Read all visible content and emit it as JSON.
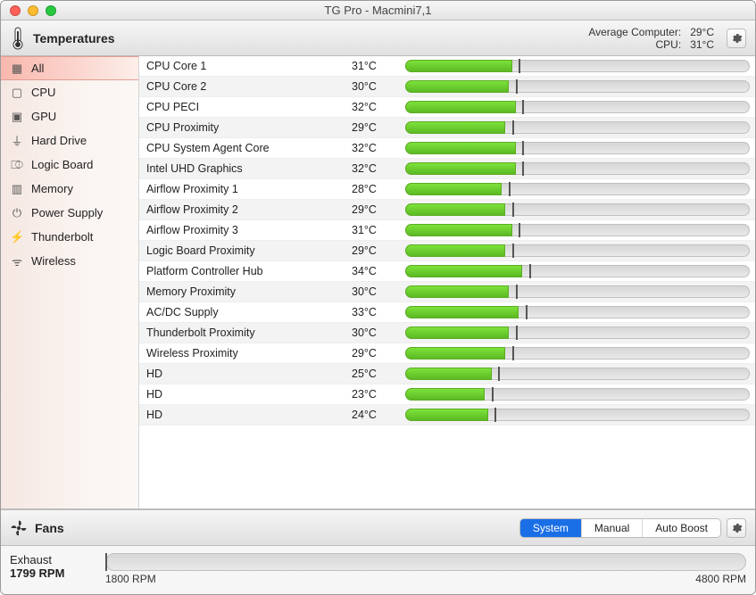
{
  "window": {
    "title": "TG Pro - Macmini7,1"
  },
  "sections": {
    "temperatures": {
      "label": "Temperatures",
      "stats": {
        "avg_label": "Average Computer:",
        "avg_value": "29°C",
        "cpu_label": "CPU:",
        "cpu_value": "31°C"
      },
      "bar_max_temp": 100
    },
    "fans": {
      "label": "Fans"
    }
  },
  "sidebar": [
    {
      "id": "all",
      "label": "All",
      "icon": "grid-icon",
      "selected": true
    },
    {
      "id": "cpu",
      "label": "CPU",
      "icon": "chip-icon",
      "selected": false
    },
    {
      "id": "gpu",
      "label": "GPU",
      "icon": "gpu-icon",
      "selected": false
    },
    {
      "id": "hd",
      "label": "Hard Drive",
      "icon": "drive-icon",
      "selected": false
    },
    {
      "id": "logic",
      "label": "Logic Board",
      "icon": "board-icon",
      "selected": false
    },
    {
      "id": "memory",
      "label": "Memory",
      "icon": "memory-icon",
      "selected": false
    },
    {
      "id": "power",
      "label": "Power Supply",
      "icon": "power-icon",
      "selected": false
    },
    {
      "id": "thunderbolt",
      "label": "Thunderbolt",
      "icon": "bolt-icon",
      "selected": false
    },
    {
      "id": "wireless",
      "label": "Wireless",
      "icon": "wifi-icon",
      "selected": false
    }
  ],
  "icon_glyphs": {
    "grid-icon": "▦",
    "chip-icon": "▢",
    "gpu-icon": "▣",
    "drive-icon": "⏚",
    "board-icon": "⎄",
    "memory-icon": "▥",
    "power-icon": "⏻",
    "bolt-icon": "⚡",
    "wifi-icon": "ᯤ"
  },
  "sensors": [
    {
      "name": "CPU Core 1",
      "temp_c": 31
    },
    {
      "name": "CPU Core 2",
      "temp_c": 30
    },
    {
      "name": "CPU PECI",
      "temp_c": 32
    },
    {
      "name": "CPU Proximity",
      "temp_c": 29
    },
    {
      "name": "CPU System Agent Core",
      "temp_c": 32
    },
    {
      "name": "Intel UHD Graphics",
      "temp_c": 32
    },
    {
      "name": "Airflow Proximity 1",
      "temp_c": 28
    },
    {
      "name": "Airflow Proximity 2",
      "temp_c": 29
    },
    {
      "name": "Airflow Proximity 3",
      "temp_c": 31
    },
    {
      "name": "Logic Board Proximity",
      "temp_c": 29
    },
    {
      "name": "Platform Controller Hub",
      "temp_c": 34
    },
    {
      "name": "Memory Proximity",
      "temp_c": 30
    },
    {
      "name": "AC/DC Supply",
      "temp_c": 33
    },
    {
      "name": "Thunderbolt Proximity",
      "temp_c": 30
    },
    {
      "name": "Wireless Proximity",
      "temp_c": 29
    },
    {
      "name": "HD",
      "temp_c": 25
    },
    {
      "name": "HD",
      "temp_c": 23
    },
    {
      "name": "HD",
      "temp_c": 24
    }
  ],
  "fans": {
    "modes": [
      {
        "id": "system",
        "label": "System",
        "selected": true
      },
      {
        "id": "manual",
        "label": "Manual",
        "selected": false
      },
      {
        "id": "auto_boost",
        "label": "Auto Boost",
        "selected": false
      }
    ],
    "items": [
      {
        "name": "Exhaust",
        "current_rpm": 1799,
        "min_rpm": 1800,
        "max_rpm": 4800
      }
    ]
  }
}
